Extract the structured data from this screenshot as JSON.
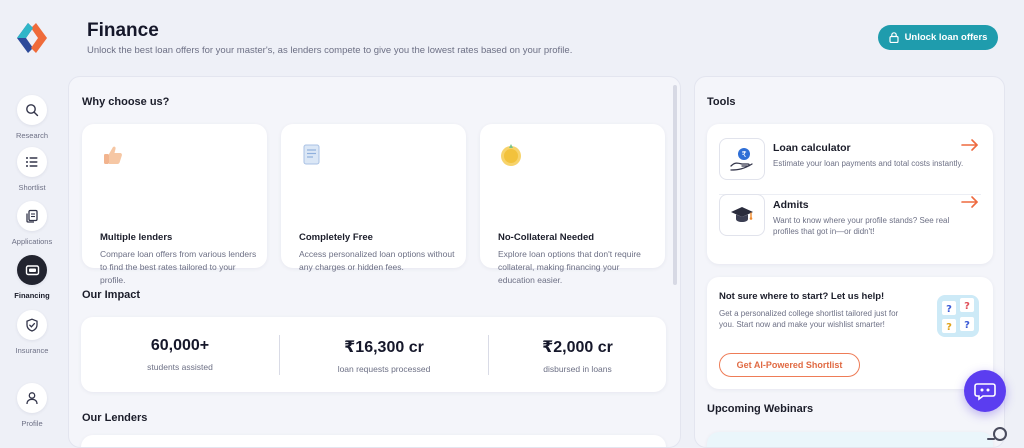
{
  "header": {
    "title": "Finance",
    "subtitle": "Unlock the best loan offers for your master's, as lenders compete to give you the lowest rates based on your profile.",
    "unlock_label": "Unlock loan offers"
  },
  "sidebar": {
    "items": [
      {
        "label": "Research",
        "icon": "search-icon"
      },
      {
        "label": "Shortlist",
        "icon": "list-icon"
      },
      {
        "label": "Applications",
        "icon": "documents-icon"
      },
      {
        "label": "Financing",
        "icon": "wallet-icon",
        "active": true
      },
      {
        "label": "Insurance",
        "icon": "shield-icon"
      },
      {
        "label": "Profile",
        "icon": "person-icon"
      }
    ]
  },
  "why": {
    "title": "Why choose us?",
    "cards": [
      {
        "title": "Multiple lenders",
        "desc": "Compare loan offers from various lenders to find the best rates tailored to your profile.",
        "icon": "thumbs-up-icon"
      },
      {
        "title": "Completely Free",
        "desc": "Access personalized loan options without any charges or hidden fees.",
        "icon": "document-icon"
      },
      {
        "title": "No-Collateral Needed",
        "desc": "Explore loan options that don't require collateral, making financing your education easier.",
        "icon": "coin-icon"
      }
    ]
  },
  "impact": {
    "title": "Our Impact",
    "stats": [
      {
        "value": "60,000+",
        "label": "students assisted"
      },
      {
        "value": "₹16,300 cr",
        "label": "loan requests processed"
      },
      {
        "value": "₹2,000 cr",
        "label": "disbursed in loans"
      }
    ]
  },
  "lenders": {
    "title": "Our Lenders"
  },
  "tools": {
    "title": "Tools",
    "items": [
      {
        "title": "Loan calculator",
        "desc": "Estimate your loan payments and total costs instantly.",
        "icon": "money-hand-icon"
      },
      {
        "title": "Admits",
        "desc": "Want to know where your profile stands? See real profiles that got in—or didn't!",
        "icon": "graduation-cap-icon"
      }
    ]
  },
  "help": {
    "title": "Not sure where to start? Let us help!",
    "desc": "Get a personalized college shortlist tailored just for you. Start now and make your wishlist smarter!",
    "button": "Get AI-Powered Shortlist"
  },
  "webinars": {
    "title": "Upcoming Webinars"
  },
  "colors": {
    "accent": "#1f9cad",
    "orange": "#ee7c57",
    "chat": "#5b3df0",
    "active_nav": "#22242f"
  }
}
